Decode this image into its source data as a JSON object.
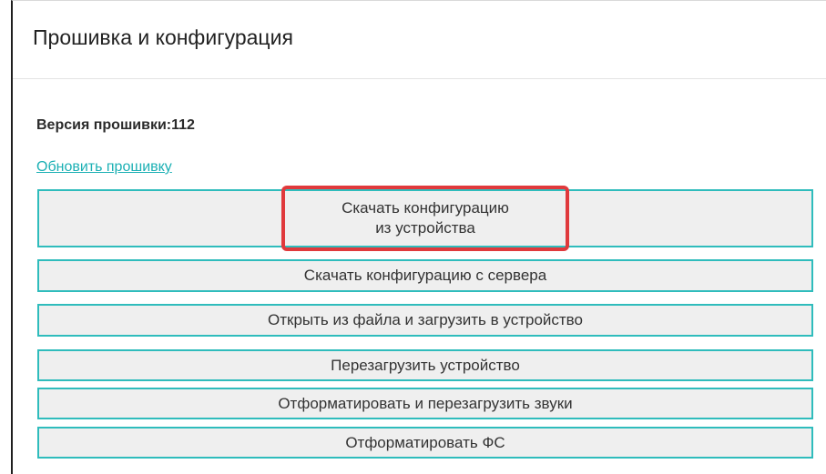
{
  "header": {
    "title": "Прошивка и конфигурация"
  },
  "firmware": {
    "version_label": "Версия прошивки:",
    "version_value": "112",
    "update_link": "Обновить прошивку"
  },
  "buttons": {
    "download_device_line1": "Скачать конфигурацию",
    "download_device_line2": "из устройства",
    "download_server": "Скачать конфигурацию с сервера",
    "open_file_upload": "Открыть из файла и загрузить в устройство",
    "reboot_device": "Перезагрузить устройство",
    "format_reboot_sounds": "Отформатировать и перезагрузить звуки",
    "format_fs": "Отформатировать ФС"
  },
  "colors": {
    "accent": "#2fbcbc",
    "link": "#1bb0b4",
    "highlight": "#e0393c",
    "button_bg": "#efefef"
  }
}
